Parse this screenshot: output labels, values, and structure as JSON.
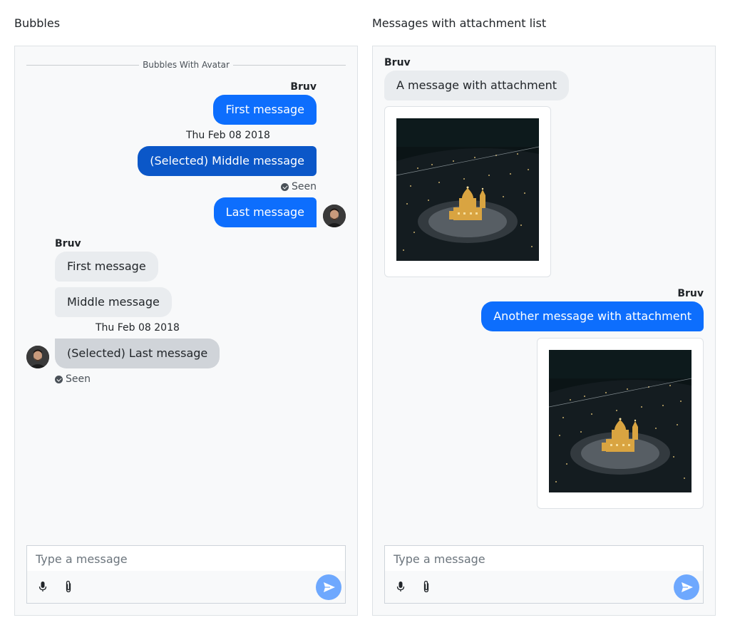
{
  "left": {
    "title": "Bubbles",
    "divider": "Bubbles With Avatar",
    "outgoing": {
      "sender": "Bruv",
      "first": "First message",
      "timestamp": "Thu Feb 08 2018",
      "middle": "(Selected) Middle message",
      "seen": "Seen",
      "last": "Last message"
    },
    "incoming": {
      "sender": "Bruv",
      "first": "First message",
      "middle": "Middle message",
      "timestamp": "Thu Feb 08 2018",
      "last": "(Selected) Last message",
      "seen": "Seen"
    },
    "composer": {
      "placeholder": "Type a message"
    }
  },
  "right": {
    "title": "Messages with attachment list",
    "incoming": {
      "sender": "Bruv",
      "text": "A message with attachment"
    },
    "outgoing": {
      "sender": "Bruv",
      "text": "Another message with attachment"
    },
    "composer": {
      "placeholder": "Type a message"
    }
  },
  "icons": {
    "mic": "microphone-icon",
    "attach": "paperclip-icon",
    "send": "send-icon",
    "seen": "check-circle-icon"
  },
  "colors": {
    "outgoing_bubble": "#0d6efd",
    "outgoing_selected": "#0b57c8",
    "incoming_bubble": "#e9ecef",
    "incoming_selected": "#d0d4d9",
    "send_button": "#6ea8fe"
  }
}
